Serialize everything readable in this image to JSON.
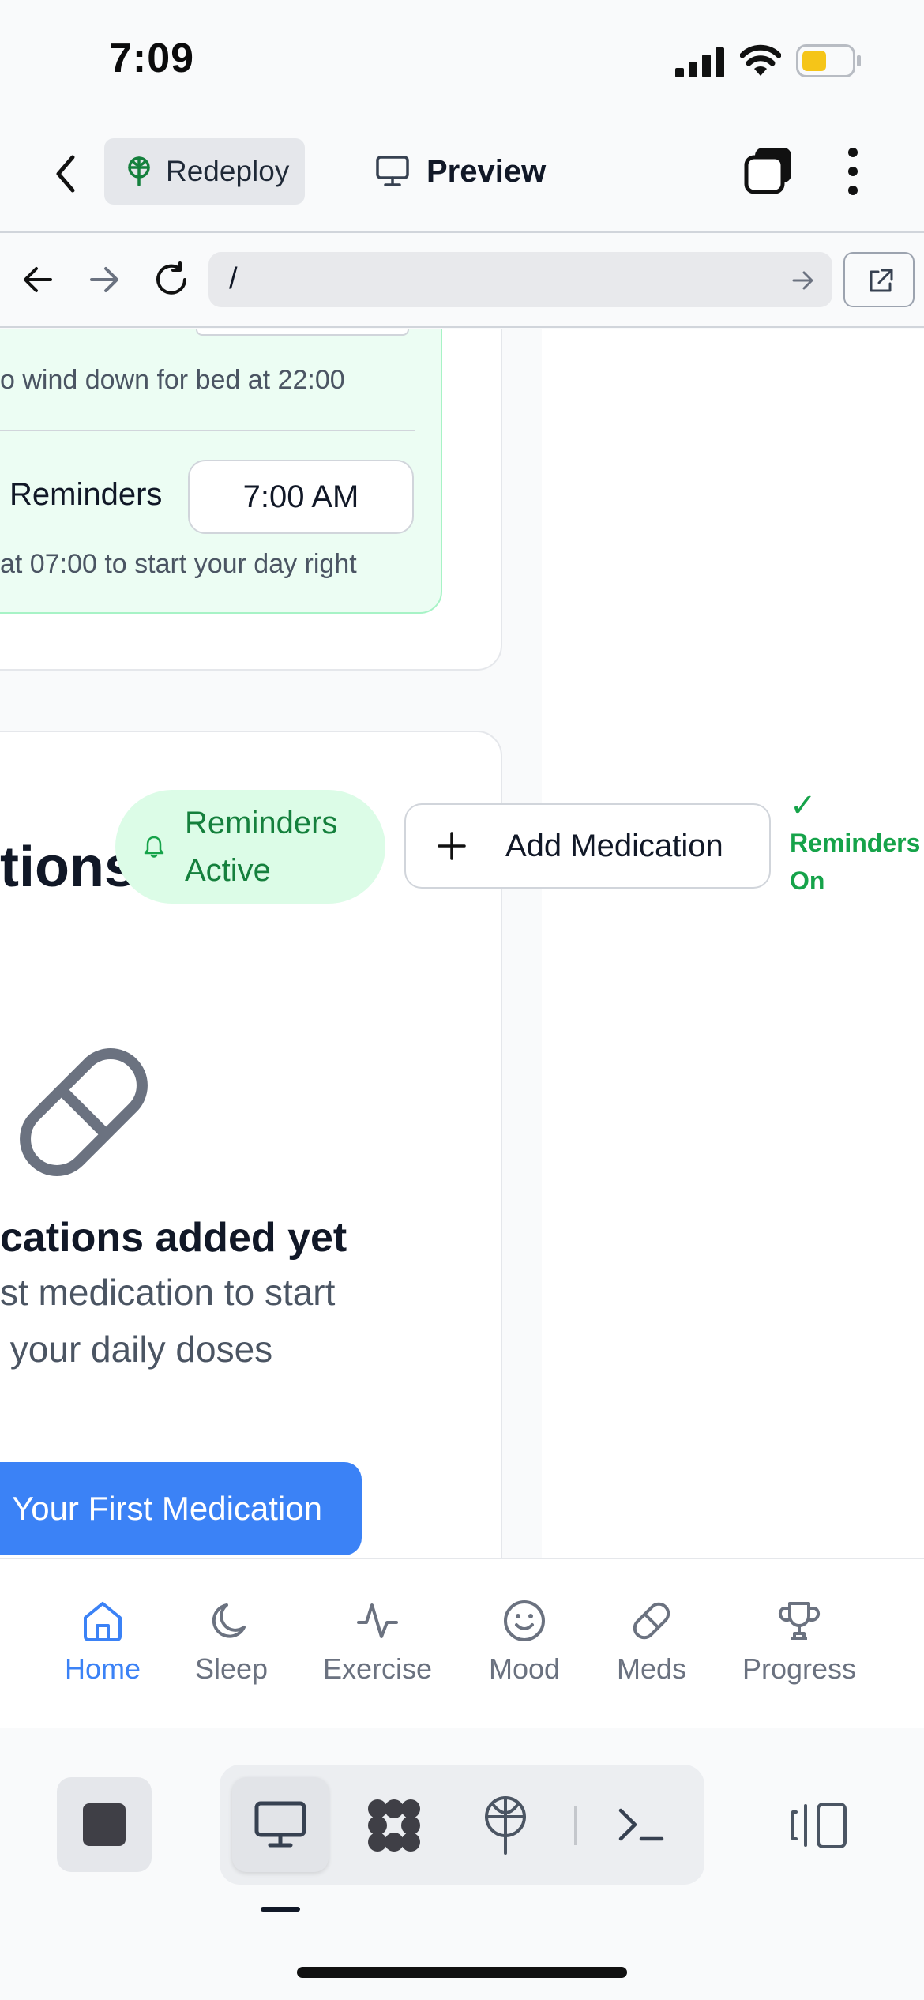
{
  "status_bar": {
    "time": "7:09"
  },
  "app_bar": {
    "redeploy_label": "Redeploy",
    "preview_label": "Preview"
  },
  "url_bar": {
    "url": "/"
  },
  "content": {
    "bedtime_desc": "o wind down for bed at 22:00",
    "morning_label": "Reminders",
    "morning_time": "7:00 AM",
    "morning_desc": "at 07:00 to start your day right",
    "meds_heading": "tions",
    "badge_line1": "Reminders",
    "badge_line2": "Active",
    "add_medication": "Add Medication",
    "reminders_on_check": "✓",
    "reminders_on_line1": "Reminders",
    "reminders_on_line2": "On",
    "empty_title": "cations added yet",
    "empty_desc_line1": "st medication to start",
    "empty_desc_line2": " your daily doses",
    "cta": "Your First Medication"
  },
  "tabs": [
    {
      "label": "Home",
      "icon": "home-icon",
      "active": true
    },
    {
      "label": "Sleep",
      "icon": "moon-icon",
      "active": false
    },
    {
      "label": "Exercise",
      "icon": "activity-icon",
      "active": false
    },
    {
      "label": "Mood",
      "icon": "smile-icon",
      "active": false
    },
    {
      "label": "Meds",
      "icon": "pill-icon",
      "active": false
    },
    {
      "label": "Progress",
      "icon": "trophy-icon",
      "active": false
    }
  ],
  "colors": {
    "accent": "#3b82f6",
    "success": "#16a34a",
    "success_bg": "#dcfce7"
  }
}
